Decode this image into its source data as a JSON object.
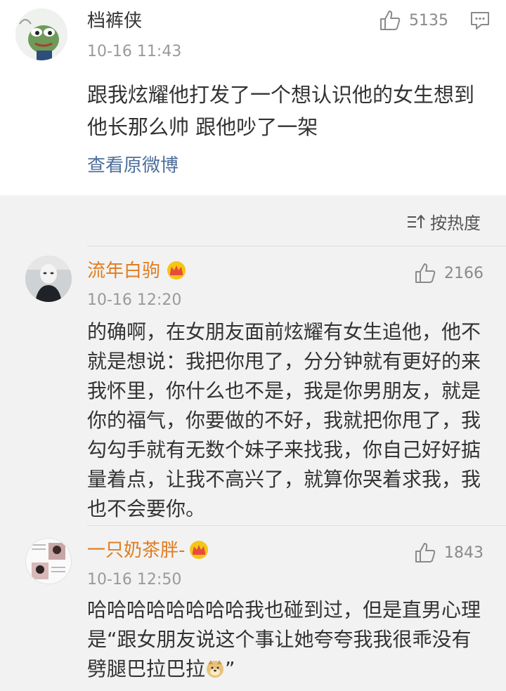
{
  "post": {
    "username": "档裤侠",
    "time": "10-16 11:43",
    "likes": "5135",
    "text": "跟我炫耀他打发了一个想认识他的女生想到他长那么帅 跟他吵了一架",
    "view_original": "查看原微博"
  },
  "sort": {
    "label": "按热度",
    "icon": "sort-icon"
  },
  "comments": [
    {
      "username": "流年白驹",
      "badge": "crown-icon",
      "time": "10-16 12:20",
      "likes": "2166",
      "text": "的确啊，在女朋友面前炫耀有女生追他，他不就是想说：我把你甩了，分分钟就有更好的来我怀里，你什么也不是，我是你男朋友，就是你的福气，你要做的不好，我就把你甩了，我勾勾手就有无数个妹子来找我，你自己好好掂量着点，让我不高兴了，就算你哭着求我，我也不会要你。"
    },
    {
      "username": "一只奶茶胖-",
      "badge": "crown-icon",
      "time": "10-16 12:50",
      "likes": "1843",
      "text": "哈哈哈哈哈哈哈哈我也碰到过，但是直男心理是“跟女朋友说这个事让她夸夸我我很乖没有劈腿巴拉巴拉",
      "text_tail": "”"
    }
  ],
  "colors": {
    "username_vip": "#e07c1e",
    "link": "#4e6f9c",
    "muted": "#9a9a9a"
  }
}
